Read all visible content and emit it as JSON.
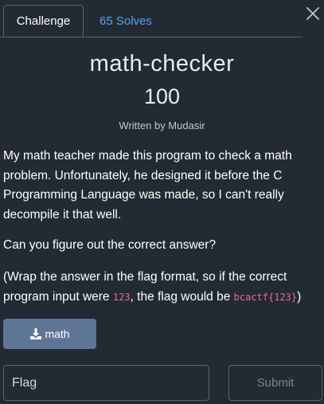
{
  "tabs": {
    "challenge_label": "Challenge",
    "solves_label": "65 Solves"
  },
  "challenge": {
    "name": "math-checker",
    "points": "100",
    "author": "Written by Mudasir",
    "description": {
      "p1": "My math teacher made this program to check a math problem. Unfortunately, he designed it before the C Programming Language was made, so I can't really decompile it that well.",
      "p2": "Can you figure out the correct answer?",
      "p3_pre": "(Wrap the answer in the flag format, so if the correct program input were ",
      "p3_code1": "123",
      "p3_mid": ", the flag would be ",
      "p3_code2": "bcactf{123}",
      "p3_post": ")"
    }
  },
  "file": {
    "label": "math",
    "icon": "download-icon"
  },
  "form": {
    "flag_placeholder": "Flag",
    "flag_value": "",
    "submit_label": "Submit"
  },
  "colors": {
    "background": "#222a33",
    "link": "#5aa0e8",
    "download_button": "#5e7596",
    "code": "#e8699a",
    "border": "#5b6470"
  }
}
